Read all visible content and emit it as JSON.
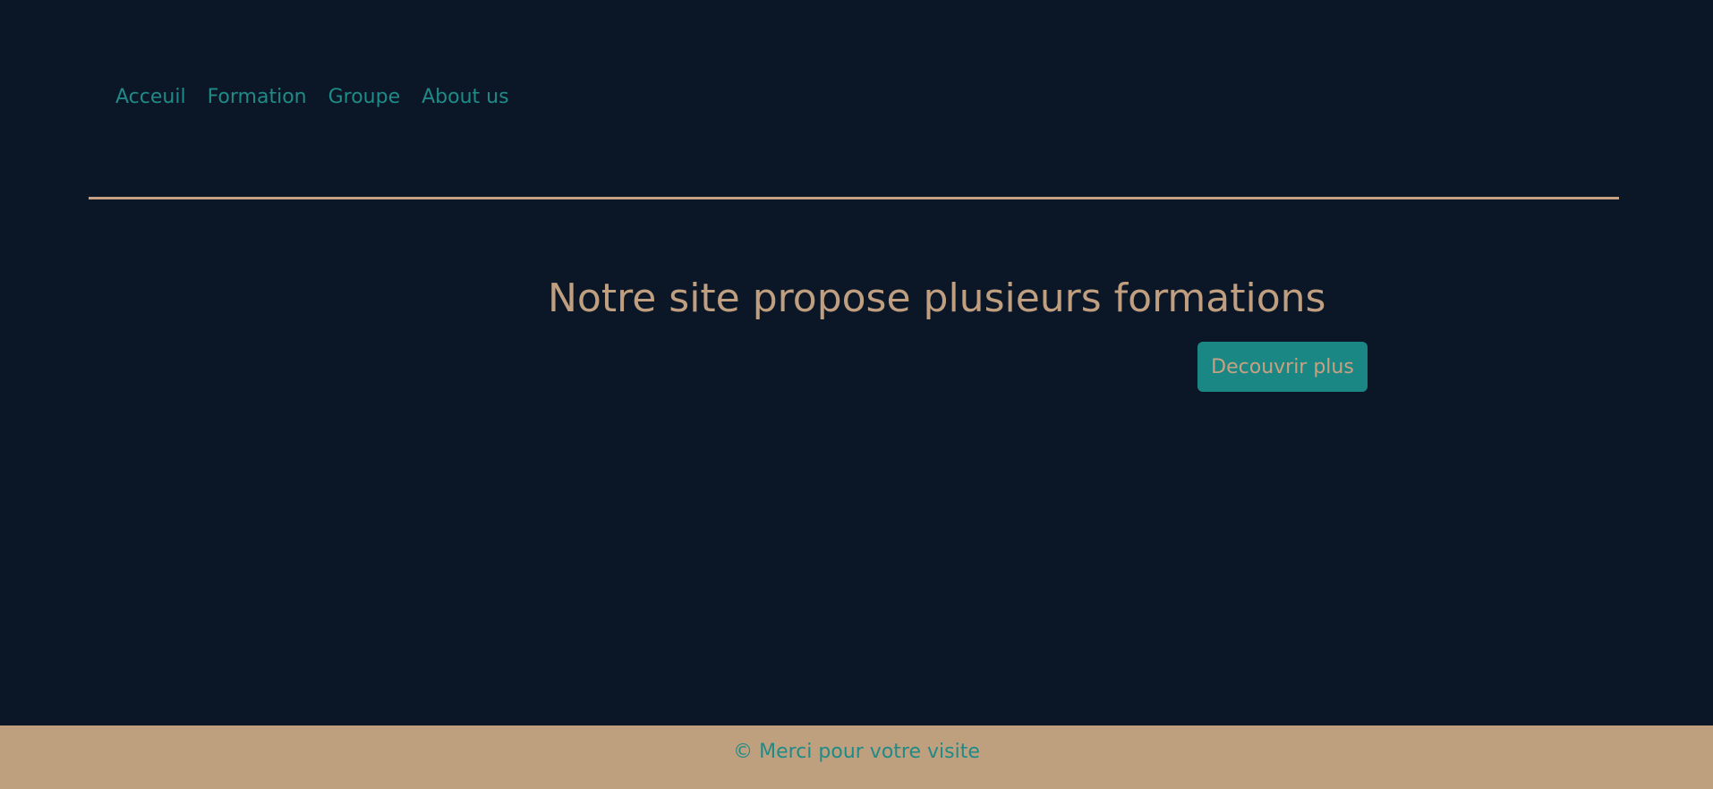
{
  "nav": {
    "items": [
      {
        "label": "Acceuil"
      },
      {
        "label": "Formation"
      },
      {
        "label": "Groupe"
      },
      {
        "label": "About us"
      }
    ]
  },
  "hero": {
    "title": "Notre site propose plusieurs formations",
    "button_label": "Decouvrir plus"
  },
  "footer": {
    "text": "© Merci pour votre visite"
  },
  "colors": {
    "background": "#0b1727",
    "accent": "#1b8785",
    "tan": "#c09f80"
  }
}
